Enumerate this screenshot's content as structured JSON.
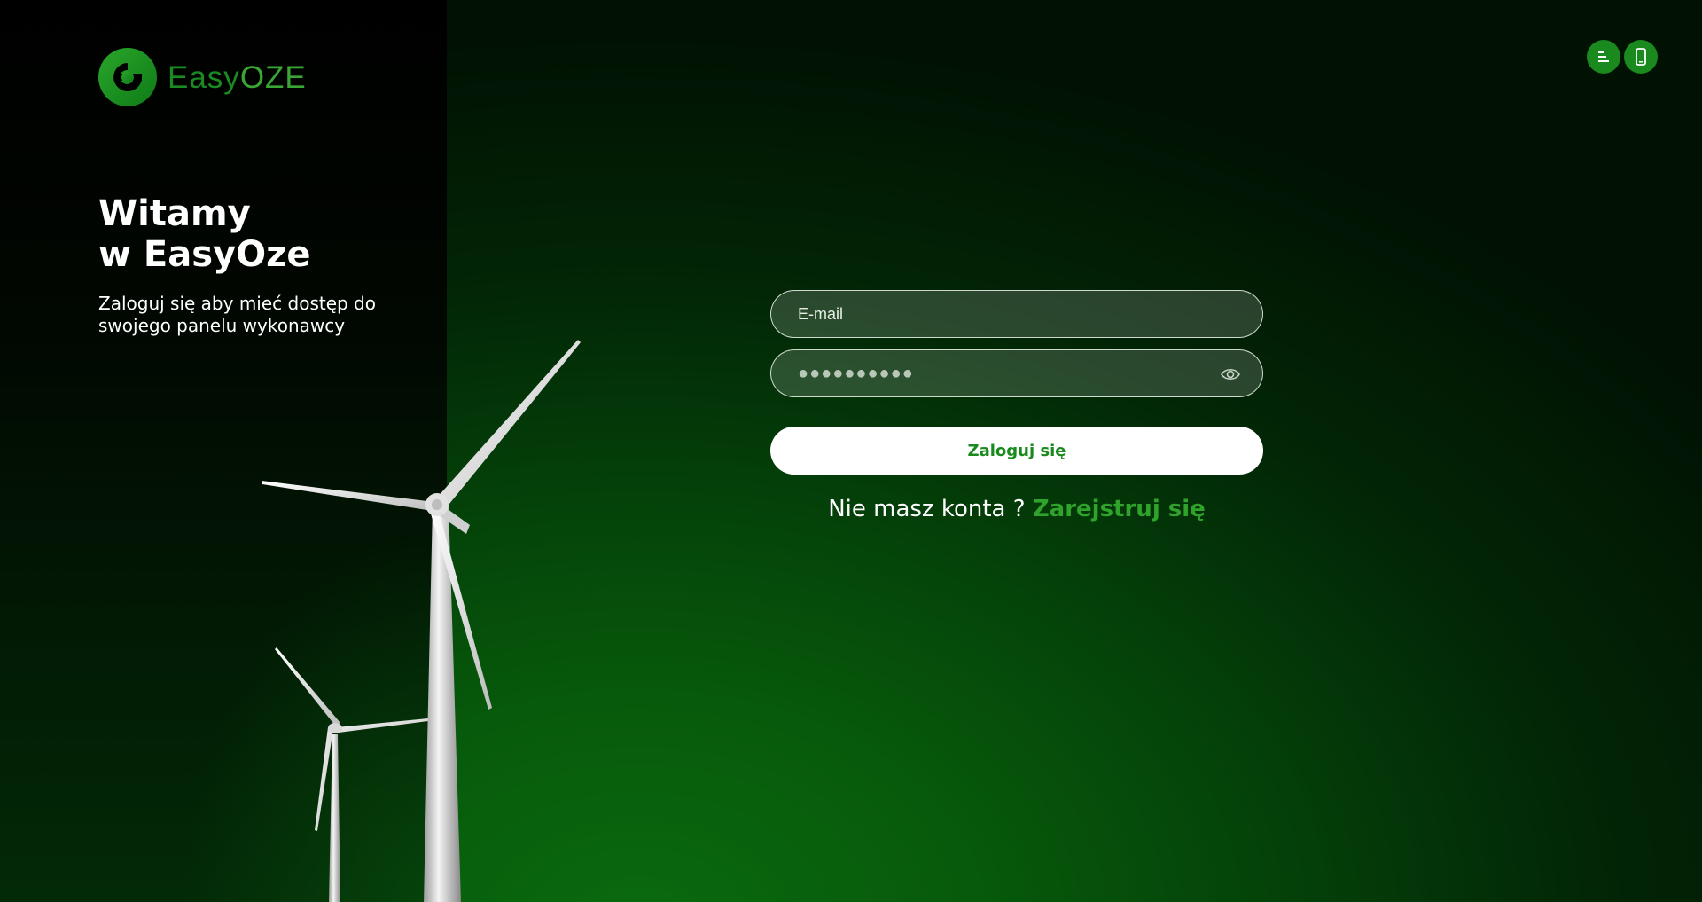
{
  "brand": {
    "name_part1": "Easy",
    "name_part2": "OZE",
    "icon": "easyoze-logo-icon",
    "colors": {
      "primary": "#1a8a1f",
      "accent": "#3aa634"
    }
  },
  "welcome": {
    "title_line1": "Witamy",
    "title_line2": "w EasyOze",
    "subtitle": "Zaloguj się aby mieć dostęp do swojego panelu wykonawcy"
  },
  "top_actions": [
    {
      "icon": "menu-lines-icon"
    },
    {
      "icon": "smartphone-icon"
    }
  ],
  "form": {
    "email_placeholder": "E-mail",
    "email_value": "",
    "password_masked": "●●●●●●●●●●",
    "password_toggle_icon": "eye-icon",
    "login_label": "Zaloguj się",
    "no_account_text": "Nie masz konta ?",
    "register_label": "Zarejstruj się"
  }
}
